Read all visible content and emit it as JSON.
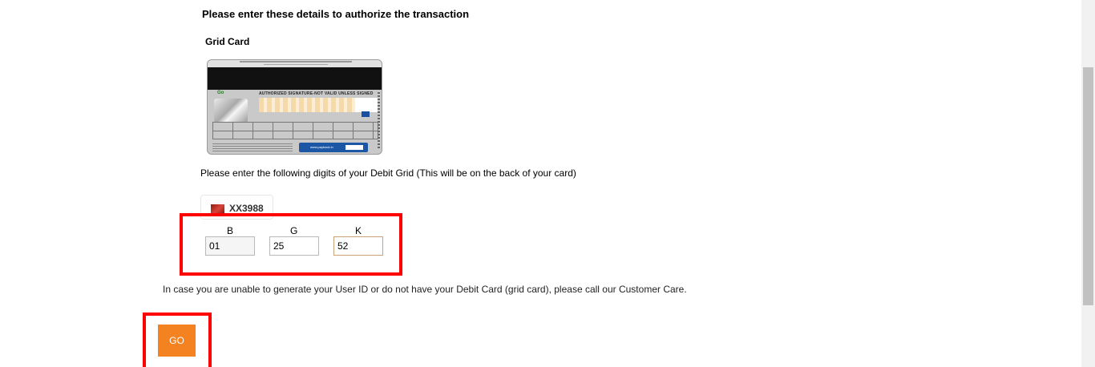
{
  "heading": "Please enter these details to authorize the transaction",
  "grid_card_title": "Grid Card",
  "card_image": {
    "signature_strip_text": "AUTHORIZED SIGNATURE-NOT VALID UNLESS SIGNED",
    "website": "www.payback.in"
  },
  "instructions": "Please enter the following digits of your Debit Grid (This will be on the back of your card)",
  "account": {
    "number": "XX3988",
    "icon": "card-flag-icon"
  },
  "grid_fields": [
    {
      "label": "B",
      "value": "01"
    },
    {
      "label": "G",
      "value": "25"
    },
    {
      "label": "K",
      "value": "52"
    }
  ],
  "note": "In case you are unable to generate your User ID or do not have your Debit Card (grid card), please call our Customer Care.",
  "go_button": "GO",
  "colors": {
    "accent": "#f58220",
    "highlight": "#ff0000"
  }
}
